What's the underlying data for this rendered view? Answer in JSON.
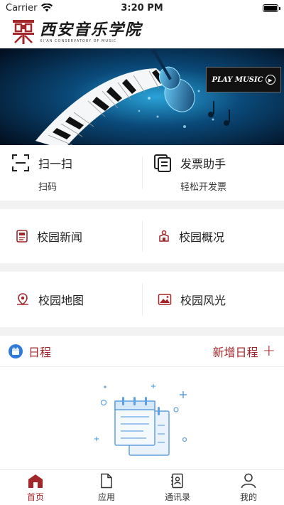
{
  "status_bar": {
    "carrier": "Carrier",
    "time": "3:20 PM"
  },
  "header": {
    "logo_cn": "西安音乐学院",
    "logo_en": "XI'AN CONSERVATORY OF MUSIC"
  },
  "banner": {
    "badge": "PLAY MUSIC"
  },
  "quick_actions": [
    {
      "title": "扫一扫",
      "subtitle": "扫码"
    },
    {
      "title": "发票助手",
      "subtitle": "轻松开发票"
    }
  ],
  "grid": [
    {
      "title": "校园新闻"
    },
    {
      "title": "校园概况"
    },
    {
      "title": "校园地图"
    },
    {
      "title": "校园风光"
    }
  ],
  "schedule": {
    "title": "日程",
    "add_label": "新增日程"
  },
  "tabs": [
    {
      "label": "首页",
      "icon": "home-icon"
    },
    {
      "label": "应用",
      "icon": "document-icon"
    },
    {
      "label": "通讯录",
      "icon": "contacts-icon"
    },
    {
      "label": "我的",
      "icon": "user-icon"
    }
  ],
  "colors": {
    "accent": "#a3262a",
    "calendar_blue": "#2e7bdc",
    "page_bg": "#f2f2f2"
  }
}
